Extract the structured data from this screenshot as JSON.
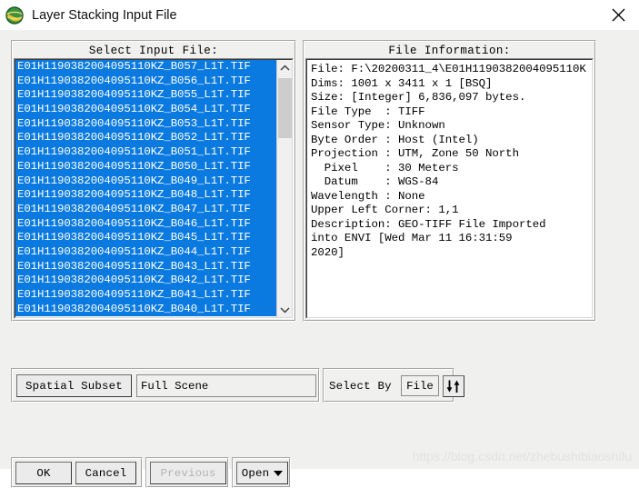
{
  "window": {
    "title": "Layer Stacking Input File",
    "icon": "envi-globe-icon",
    "close_label": "✕"
  },
  "left_panel": {
    "title": "Select Input File:",
    "files": [
      "E01H1190382004095110KZ_B057_L1T.TIF",
      "E01H1190382004095110KZ_B056_L1T.TIF",
      "E01H1190382004095110KZ_B055_L1T.TIF",
      "E01H1190382004095110KZ_B054_L1T.TIF",
      "E01H1190382004095110KZ_B053_L1T.TIF",
      "E01H1190382004095110KZ_B052_L1T.TIF",
      "E01H1190382004095110KZ_B051_L1T.TIF",
      "E01H1190382004095110KZ_B050_L1T.TIF",
      "E01H1190382004095110KZ_B049_L1T.TIF",
      "E01H1190382004095110KZ_B048_L1T.TIF",
      "E01H1190382004095110KZ_B047_L1T.TIF",
      "E01H1190382004095110KZ_B046_L1T.TIF",
      "E01H1190382004095110KZ_B045_L1T.TIF",
      "E01H1190382004095110KZ_B044_L1T.TIF",
      "E01H1190382004095110KZ_B043_L1T.TIF",
      "E01H1190382004095110KZ_B042_L1T.TIF",
      "E01H1190382004095110KZ_B041_L1T.TIF",
      "E01H1190382004095110KZ_B040_L1T.TIF"
    ],
    "scroll_up_icon": "chevron-up-icon",
    "scroll_down_icon": "chevron-down-icon"
  },
  "right_panel": {
    "title": "File Information:",
    "lines": [
      "File: F:\\20200311_4\\E01H1190382004095110K",
      "Dims: 1001 x 3411 x 1 [BSQ]",
      "Size: [Integer] 6,836,097 bytes.",
      "File Type  : TIFF",
      "Sensor Type: Unknown",
      "Byte Order : Host (Intel)",
      "Projection : UTM, Zone 50 North",
      "  Pixel    : 30 Meters",
      "  Datum    : WGS-84",
      "Wavelength : None",
      "Upper Left Corner: 1,1",
      "Description: GEO-TIFF File Imported",
      "into ENVI [Wed Mar 11 16:31:59",
      "2020]"
    ]
  },
  "subset": {
    "spatial_subset_label": "Spatial Subset",
    "extent_value": "Full Scene"
  },
  "select_by": {
    "label": "Select By",
    "value": "File",
    "sort_icon": "sort-updown-icon"
  },
  "buttons": {
    "ok": "OK",
    "cancel": "Cancel",
    "previous": "Previous",
    "open": "Open",
    "open_caret_icon": "caret-down-icon"
  },
  "watermark": {
    "text": "https://blog.csdn.net/zhebushibiaoshifu"
  }
}
